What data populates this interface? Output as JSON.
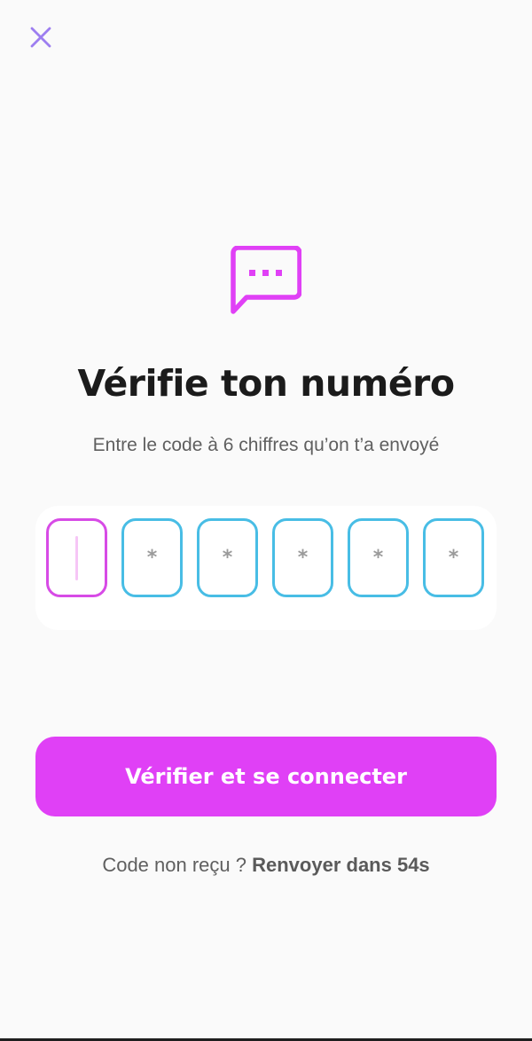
{
  "close_icon": "close-icon",
  "header": {
    "icon": "chat-bubble-dots-icon",
    "title": "Vérifie ton numéro",
    "subtitle": "Entre le code à 6 chiffres qu’on t’a envoyé"
  },
  "code": {
    "length": 6,
    "active_index": 0,
    "digits": [
      "",
      "*",
      "*",
      "*",
      "*",
      "*"
    ]
  },
  "primary_button": {
    "label": "Vérifier et se connecter"
  },
  "resend": {
    "prompt": "Code non reçu ?",
    "link": "Renvoyer dans 54s"
  },
  "colors": {
    "accent": "#e040f6",
    "close_icon": "#9d7ef0",
    "box_border": "#48bde5",
    "box_border_active": "#d74be6",
    "background": "#fafafa"
  }
}
